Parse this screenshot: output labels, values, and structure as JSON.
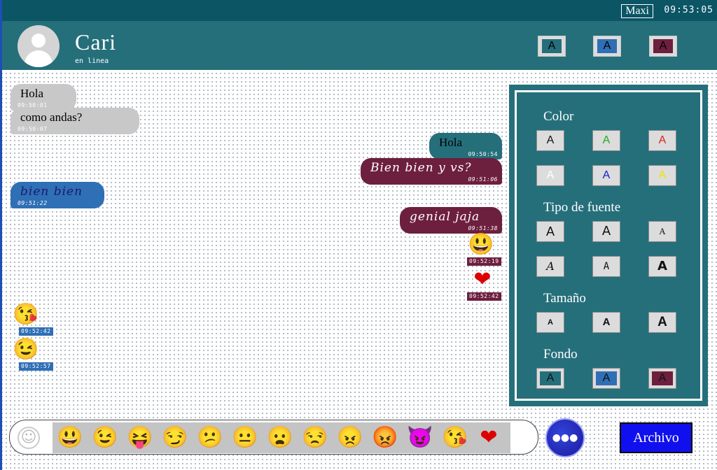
{
  "topbar": {
    "user": "Maxi",
    "clock": "09:53:05"
  },
  "header": {
    "contact_name": "Cari",
    "contact_status": "en linea",
    "theme_buttons": [
      "A",
      "A",
      "A"
    ],
    "theme_colors": [
      "#256f7b",
      "#2f6fb5",
      "#6d1f3e"
    ]
  },
  "messages": [
    {
      "text": "Hola",
      "time": "09:50:01"
    },
    {
      "text": "como andas?",
      "time": "09:50:07"
    },
    {
      "text": "Hola",
      "time": "09:50:54"
    },
    {
      "text": "Bien bien y vs?",
      "time": "09:51:06"
    },
    {
      "text": "bien bien",
      "time": "09:51:22"
    },
    {
      "text": "genial jaja",
      "time": "09:51:38"
    },
    {
      "emoji": "😃",
      "time": "09:52:19"
    },
    {
      "emoji": "❤",
      "time": "09:52:42"
    },
    {
      "emoji": "😘",
      "time": "09:52:42"
    },
    {
      "emoji": "😉",
      "time": "09:52:57"
    }
  ],
  "panel": {
    "color_title": "Color",
    "font_title": "Tipo de fuente",
    "size_title": "Tamaño",
    "bg_title": "Fondo",
    "color_opts": [
      "A",
      "A",
      "A",
      "A",
      "A",
      "A"
    ],
    "color_hex": [
      "#111111",
      "#22aa22",
      "#dd2222",
      "#ffffff",
      "#1a1ad0",
      "#f2e000"
    ],
    "font_opts": [
      "A",
      "A",
      "A",
      "A",
      "A",
      "A"
    ],
    "size_opts": [
      "A",
      "A",
      "A"
    ],
    "bg_opts": [
      "A",
      "A",
      "A"
    ],
    "bg_hex": [
      "#256f7b",
      "#2f6fb5",
      "#6d1f3e"
    ]
  },
  "bottombar": {
    "smiley_icon": "☺",
    "emojis": [
      "😃",
      "😉",
      "😝",
      "😏",
      "😕",
      "😐",
      "😦",
      "😒",
      "😠",
      "😡",
      "😈",
      "😘",
      "❤"
    ],
    "globe_icon": "globe-icon",
    "file_button": "Archivo"
  }
}
